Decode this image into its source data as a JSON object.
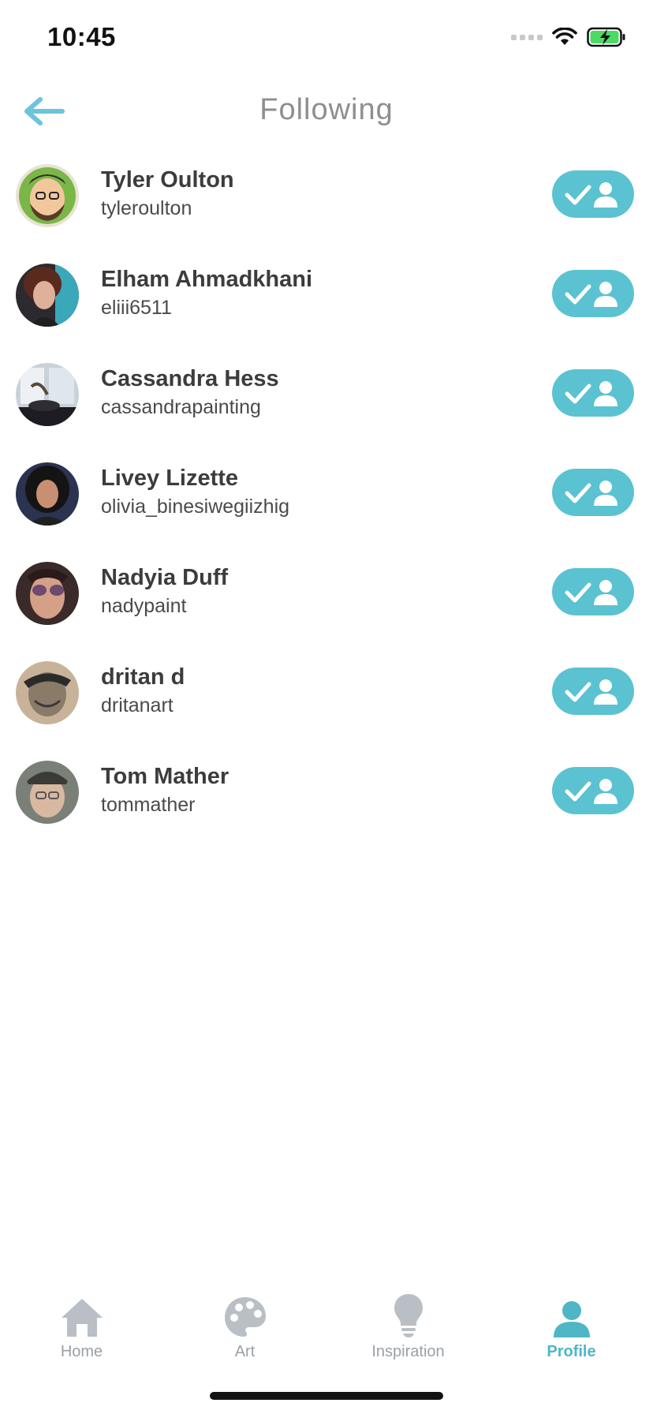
{
  "status_bar": {
    "time": "10:45"
  },
  "header": {
    "title": "Following"
  },
  "following": [
    {
      "name": "Tyler Oulton",
      "handle": "tyleroulton"
    },
    {
      "name": "Elham Ahmadkhani",
      "handle": "eliii6511"
    },
    {
      "name": "Cassandra Hess",
      "handle": "cassandrapainting"
    },
    {
      "name": "Livey Lizette",
      "handle": "olivia_binesiwegiizhig"
    },
    {
      "name": "Nadyia Duff",
      "handle": "nadypaint"
    },
    {
      "name": "dritan d",
      "handle": "dritanart"
    },
    {
      "name": "Tom Mather",
      "handle": "tommather"
    }
  ],
  "tabs": [
    {
      "label": "Home",
      "icon": "home-icon"
    },
    {
      "label": "Art",
      "icon": "palette-icon"
    },
    {
      "label": "Inspiration",
      "icon": "lightbulb-icon"
    },
    {
      "label": "Profile",
      "icon": "person-icon",
      "active": true
    }
  ],
  "colors": {
    "accent": "#5bc2d1",
    "back_arrow": "#6cc3dc",
    "inactive_tab": "#b9bfc5",
    "title": "#8e8e8e"
  }
}
